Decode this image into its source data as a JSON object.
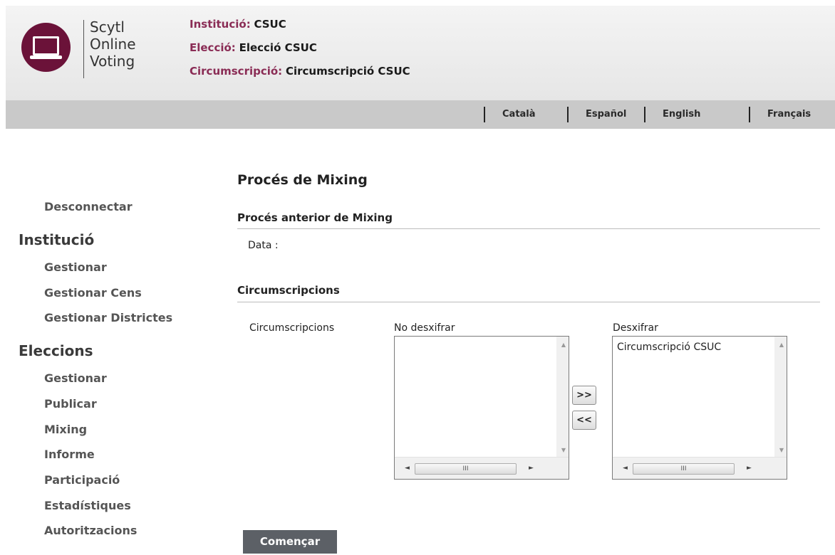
{
  "brand": {
    "line1": "Scytl",
    "line2": "Online",
    "line3": "Voting",
    "color": "#6b1239"
  },
  "info": {
    "institution_label": "Institució:",
    "institution_value": "CSUC",
    "election_label": "Elecció:",
    "election_value": "Elecció CSUC",
    "district_label": "Circumscripció:",
    "district_value": "Circumscripció CSUC"
  },
  "languages": [
    "Català",
    "Español",
    "English",
    "Français"
  ],
  "sidebar": {
    "logout": "Desconnectar",
    "institution_heading": "Institució",
    "institution_items": [
      "Gestionar",
      "Gestionar Cens",
      "Gestionar Districtes"
    ],
    "elections_heading": "Eleccions",
    "election_items": [
      "Gestionar",
      "Publicar",
      "Mixing",
      "Informe",
      "Participació",
      "Estadístiques",
      "Autoritzacions"
    ]
  },
  "main": {
    "title": "Procés de Mixing",
    "previous_section": "Procés anterior de Mixing",
    "date_label": "Data :",
    "districts_section": "Circumscripcions",
    "districts_label": "Circumscripcions",
    "left_list_label": "No desxifrar",
    "left_list_items": [],
    "right_list_label": "Desxifrar",
    "right_list_items": [
      "Circumscripció CSUC"
    ],
    "move_right_label": ">>",
    "move_left_label": "<<",
    "start_button": "Començar"
  },
  "scroll_glyphs": {
    "up": "▲",
    "down": "▼",
    "left": "◄",
    "right": "►",
    "thumb": "III"
  }
}
